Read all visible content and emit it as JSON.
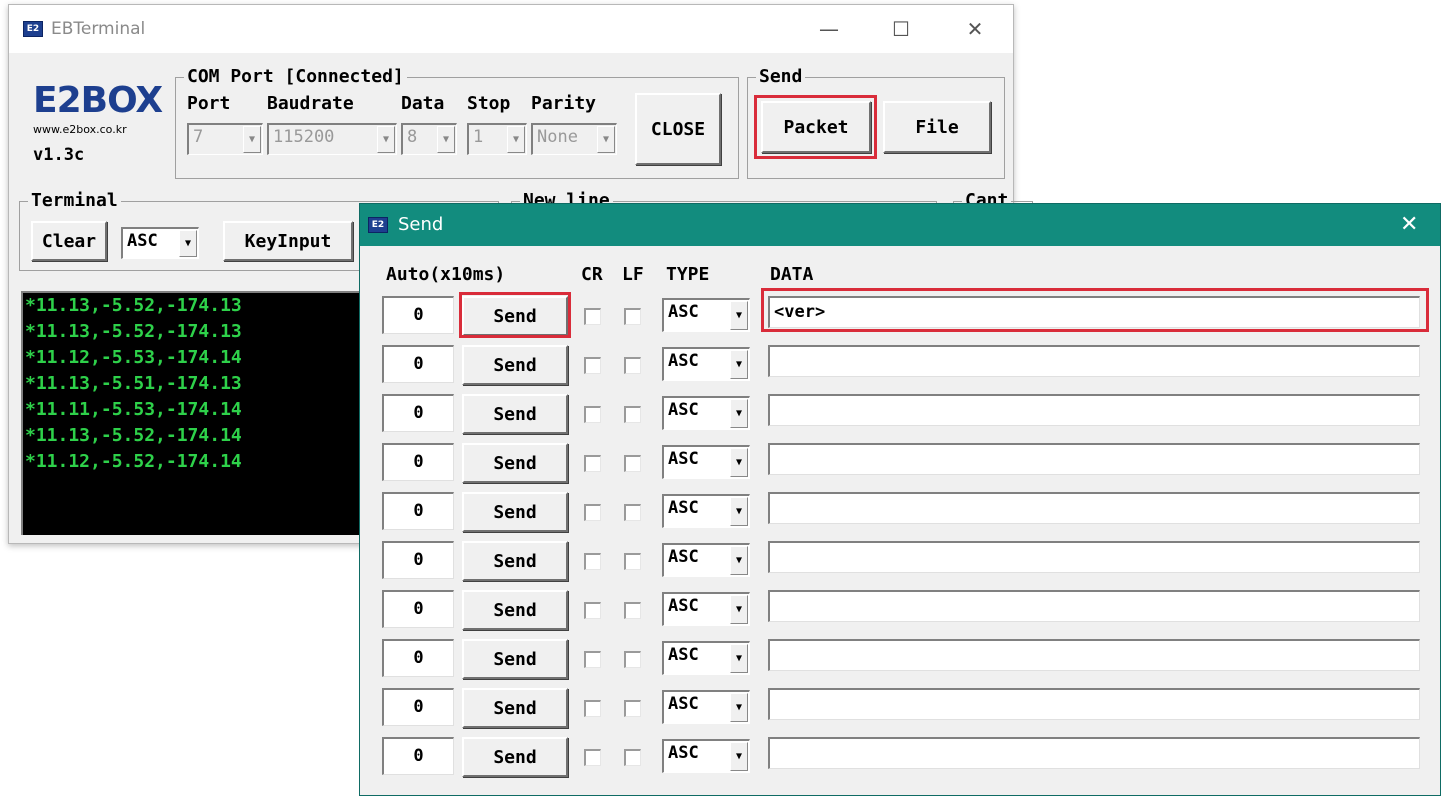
{
  "main_window": {
    "title": "EBTerminal",
    "app_icon": "E2",
    "logo": {
      "text": "E2BOX",
      "url": "www.e2box.co.kr"
    },
    "version": "v1.3c",
    "com_port": {
      "legend": "COM Port [Connected]",
      "labels": {
        "port": "Port",
        "baudrate": "Baudrate",
        "data": "Data",
        "stop": "Stop",
        "parity": "Parity"
      },
      "values": {
        "port": "7",
        "baudrate": "115200",
        "data": "8",
        "stop": "1",
        "parity": "None"
      },
      "close_label": "CLOSE"
    },
    "send": {
      "legend": "Send",
      "packet_label": "Packet",
      "file_label": "File"
    },
    "terminal": {
      "legend": "Terminal",
      "clear_label": "Clear",
      "mode": "ASC",
      "keyinput_label": "KeyInput",
      "lines": [
        "*11.13,-5.52,-174.13",
        "*11.13,-5.52,-174.13",
        "*11.12,-5.53,-174.14",
        "*11.13,-5.51,-174.13",
        "*11.11,-5.53,-174.14",
        "*11.13,-5.52,-174.14",
        "*11.12,-5.52,-174.14"
      ],
      "text_color": "#2ed14a"
    },
    "newline_legend": "New line",
    "cant_legend": "Cant"
  },
  "send_window": {
    "title": "Send",
    "title_color": "#128c7e",
    "close_glyph": "✕",
    "headers": {
      "auto": "Auto(x10ms)",
      "cr": "CR",
      "lf": "LF",
      "type": "TYPE",
      "data": "DATA"
    },
    "rows": [
      {
        "auto": "0",
        "send": "Send",
        "type": "ASC",
        "data": "<ver>"
      },
      {
        "auto": "0",
        "send": "Send",
        "type": "ASC",
        "data": ""
      },
      {
        "auto": "0",
        "send": "Send",
        "type": "ASC",
        "data": ""
      },
      {
        "auto": "0",
        "send": "Send",
        "type": "ASC",
        "data": ""
      },
      {
        "auto": "0",
        "send": "Send",
        "type": "ASC",
        "data": ""
      },
      {
        "auto": "0",
        "send": "Send",
        "type": "ASC",
        "data": ""
      },
      {
        "auto": "0",
        "send": "Send",
        "type": "ASC",
        "data": ""
      },
      {
        "auto": "0",
        "send": "Send",
        "type": "ASC",
        "data": ""
      },
      {
        "auto": "0",
        "send": "Send",
        "type": "ASC",
        "data": ""
      },
      {
        "auto": "0",
        "send": "Send",
        "type": "ASC",
        "data": ""
      }
    ]
  },
  "highlight_color": "#d92c3a"
}
